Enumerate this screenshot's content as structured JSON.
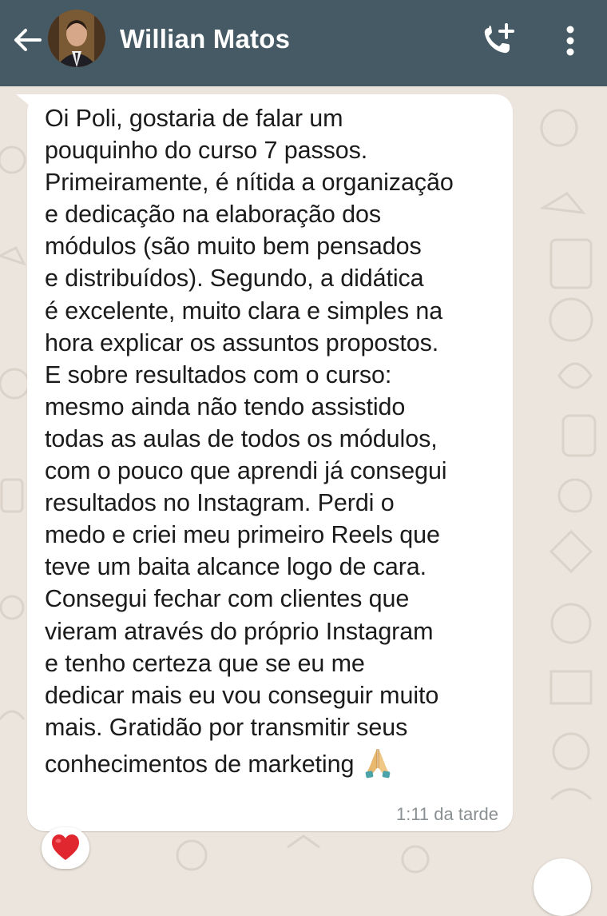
{
  "header": {
    "contact_name": "Willian Matos",
    "back_icon": "arrow-left-icon",
    "call_icon": "add-call-icon",
    "menu_icon": "vertical-dots-icon",
    "background": "#455a64"
  },
  "message": {
    "lines": [
      "Oi Poli, gostaria de falar um",
      "pouquinho do curso 7 passos.",
      "Primeiramente, é nítida a organização",
      "e dedicação na elaboração dos",
      "módulos (são muito bem pensados",
      "e distribuídos). Segundo, a didática",
      "é excelente, muito clara e simples na",
      "hora explicar os assuntos propostos.",
      "E sobre resultados com o curso:",
      "mesmo ainda não tendo assistido",
      "todas as aulas de todos os módulos,",
      "com o pouco que aprendi já consegui",
      "resultados no Instagram. Perdi o",
      "medo e criei meu primeiro Reels que",
      "teve um baita alcance logo de cara.",
      "Consegui fechar com clientes que",
      "vieram através do próprio Instagram",
      "e tenho certeza que se eu me",
      "dedicar mais eu vou conseguir muito",
      "mais. Gratidão por transmitir seus",
      "conhecimentos de marketing"
    ],
    "emoji": "praying-hands-icon",
    "time": "1:11 da tarde"
  },
  "reaction": {
    "icon": "red-heart-icon",
    "color": "#e0262f"
  }
}
